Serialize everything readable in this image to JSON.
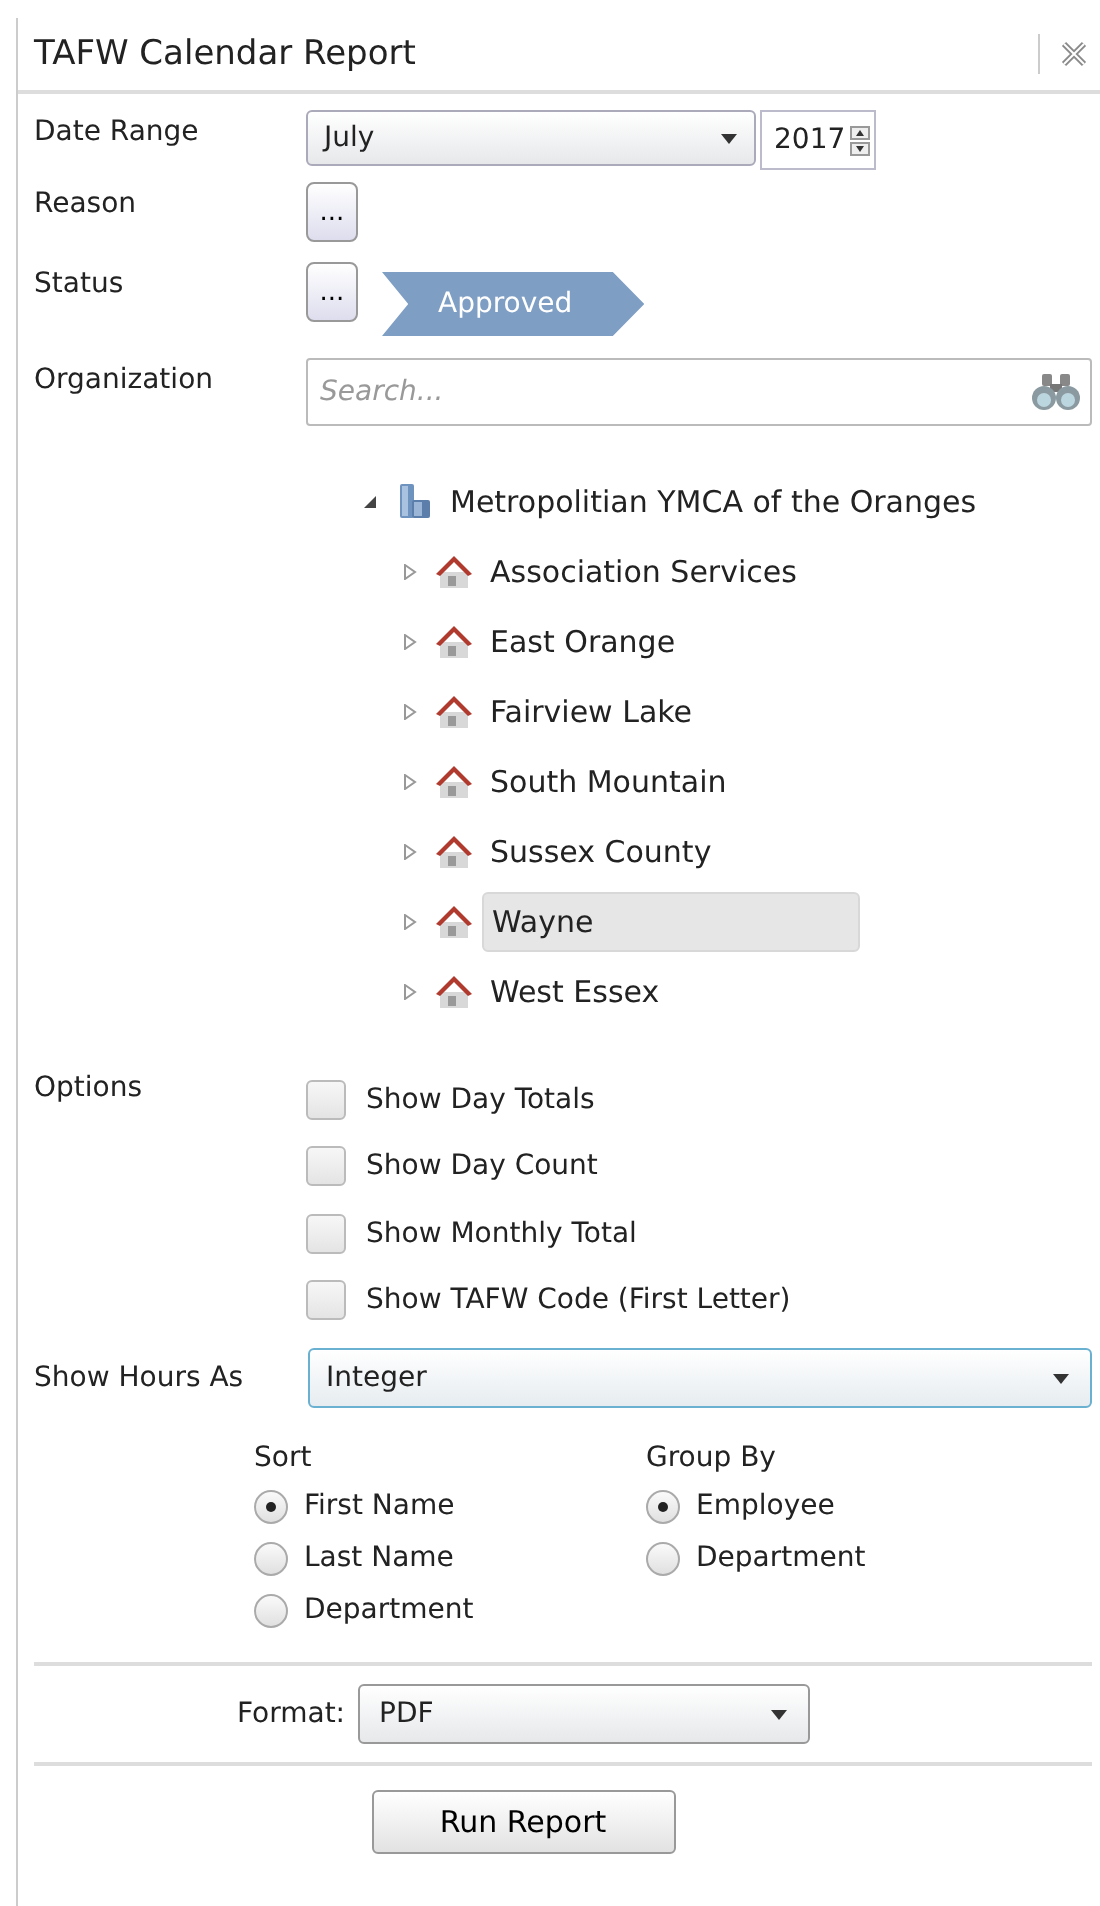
{
  "window": {
    "title": "TAFW Calendar Report"
  },
  "date_range": {
    "label": "Date Range",
    "month": "July",
    "year": "2017"
  },
  "reason": {
    "label": "Reason",
    "button": "..."
  },
  "status": {
    "label": "Status",
    "button": "...",
    "tags": [
      "Approved"
    ]
  },
  "organization": {
    "label": "Organization",
    "placeholder": "Search...",
    "tree": [
      {
        "label": "Metropolitian YMCA of the Oranges",
        "kind": "org",
        "expanded": true,
        "selected": false,
        "children": [
          {
            "label": "Association Services",
            "kind": "branch",
            "expanded": false,
            "selected": false
          },
          {
            "label": "East Orange",
            "kind": "branch",
            "expanded": false,
            "selected": false
          },
          {
            "label": "Fairview Lake",
            "kind": "branch",
            "expanded": false,
            "selected": false
          },
          {
            "label": "South Mountain",
            "kind": "branch",
            "expanded": false,
            "selected": false
          },
          {
            "label": "Sussex County",
            "kind": "branch",
            "expanded": false,
            "selected": false
          },
          {
            "label": "Wayne",
            "kind": "branch",
            "expanded": false,
            "selected": true
          },
          {
            "label": "West Essex",
            "kind": "branch",
            "expanded": false,
            "selected": false
          }
        ]
      }
    ]
  },
  "options": {
    "label": "Options",
    "items": [
      {
        "label": "Show Day Totals",
        "checked": false
      },
      {
        "label": "Show Day Count",
        "checked": false
      },
      {
        "label": "Show Monthly Total",
        "checked": false
      },
      {
        "label": "Show TAFW Code (First Letter)",
        "checked": false
      }
    ]
  },
  "show_hours_as": {
    "label": "Show Hours As",
    "value": "Integer"
  },
  "sort": {
    "label": "Sort",
    "items": [
      {
        "label": "First Name",
        "selected": true
      },
      {
        "label": "Last Name",
        "selected": false
      },
      {
        "label": "Department",
        "selected": false
      }
    ]
  },
  "group_by": {
    "label": "Group By",
    "items": [
      {
        "label": "Employee",
        "selected": true
      },
      {
        "label": "Department",
        "selected": false
      }
    ]
  },
  "format": {
    "label": "Format:",
    "value": "PDF"
  },
  "run_button": "Run Report"
}
